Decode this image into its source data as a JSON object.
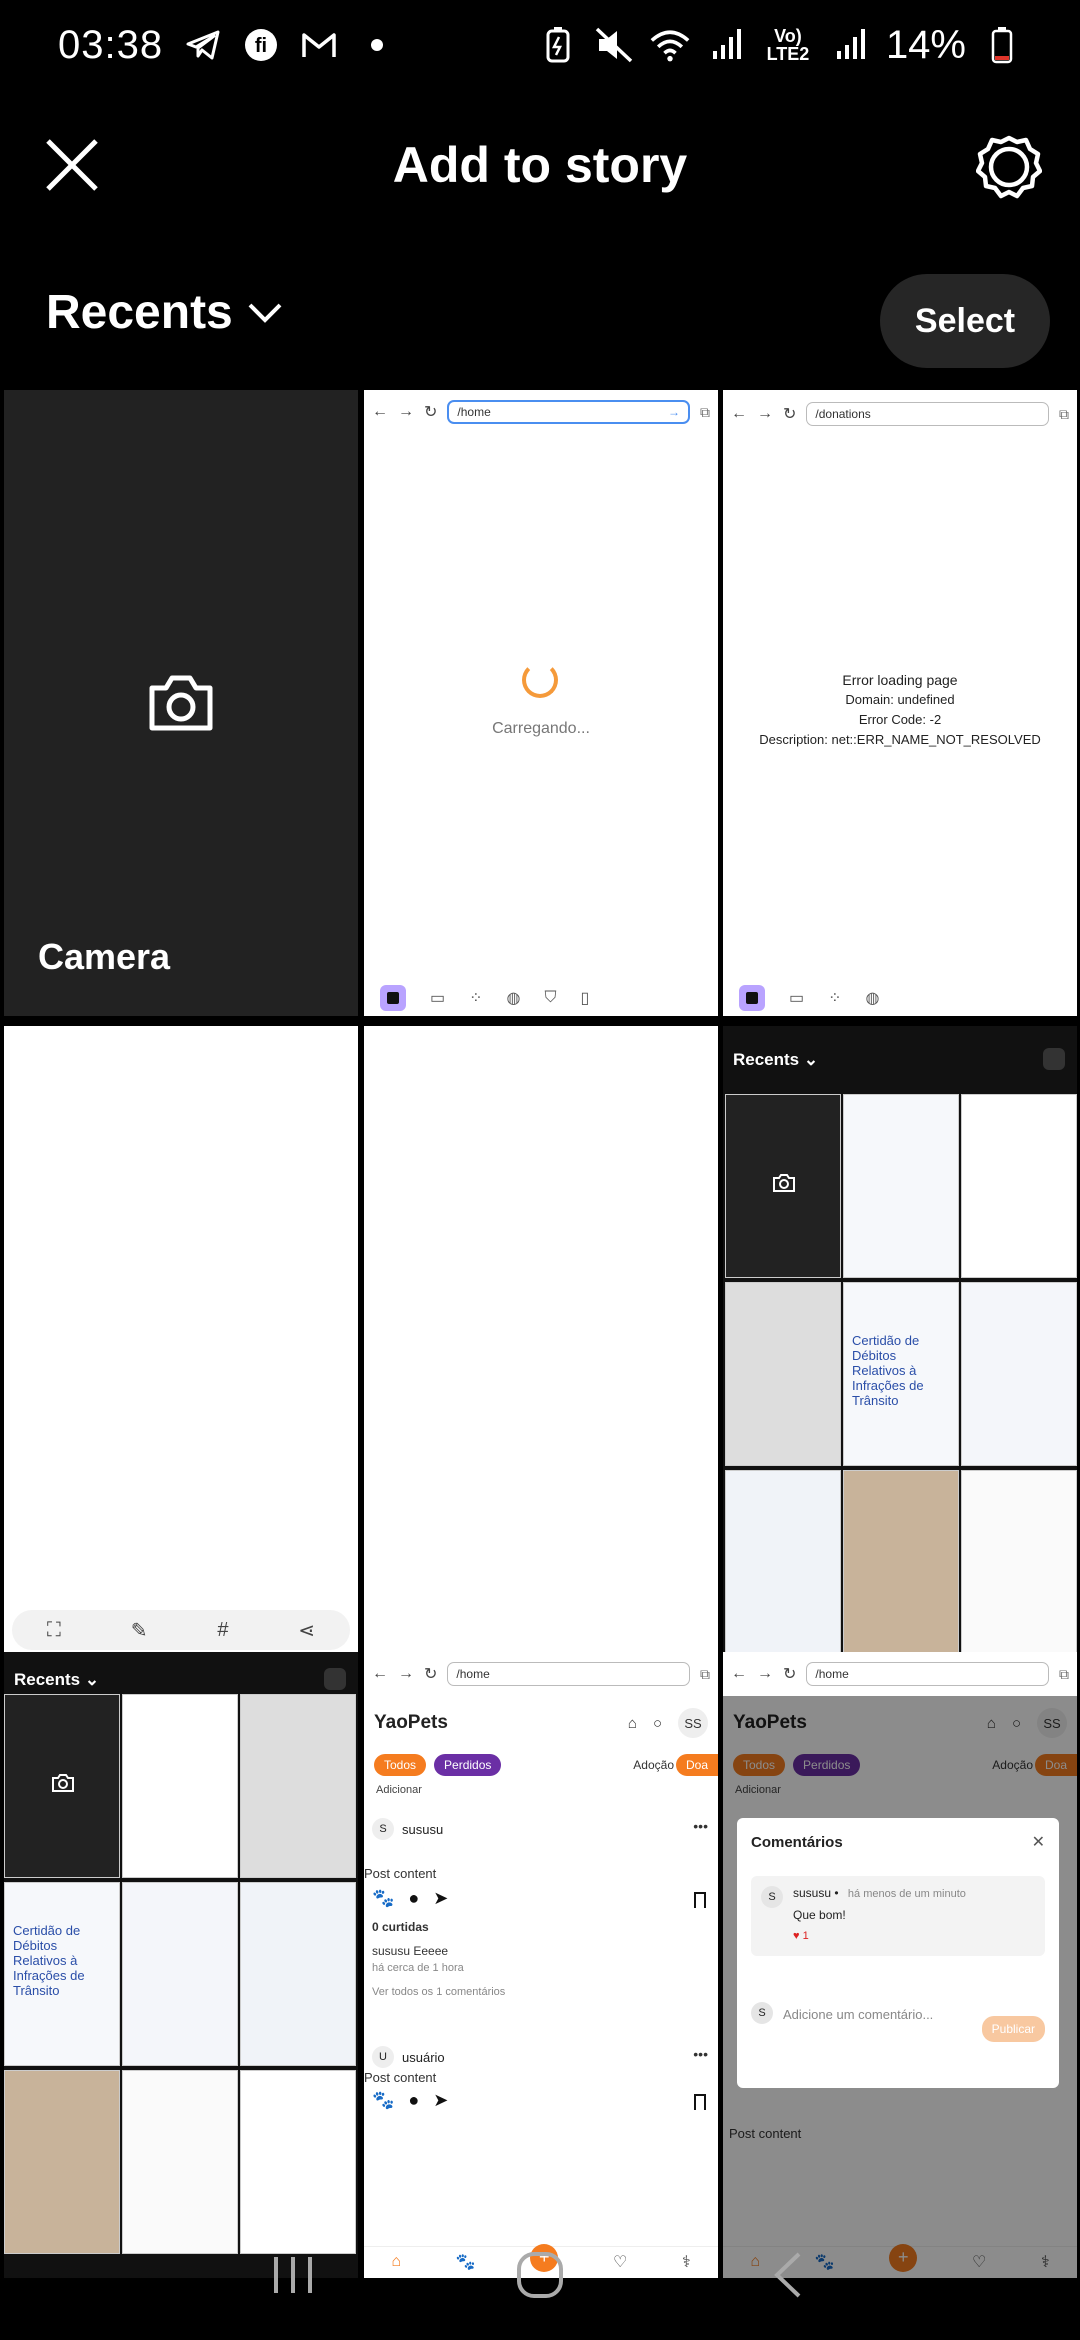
{
  "status_bar": {
    "time": "03:38",
    "battery": "14%",
    "network": "Vo) LTE2",
    "icons": [
      "telegram-icon",
      "threads-icon",
      "gmail-icon",
      "dot-icon",
      "battery-saver-icon",
      "mute-icon",
      "wifi-icon",
      "signal-icon",
      "battery-icon"
    ]
  },
  "header": {
    "title": "Add to story"
  },
  "recents": {
    "label": "Recents",
    "select_label": "Select"
  },
  "tiles": {
    "camera": {
      "label": "Camera"
    },
    "loading": {
      "url": "/home",
      "text": "Carregando..."
    },
    "error": {
      "url": "/donations",
      "title": "Error loading page",
      "domain": "Domain: undefined",
      "code": "Error Code: -2",
      "description": "Description: net::ERR_NAME_NOT_RESOLVED"
    },
    "nested": {
      "label": "Recents",
      "cert_title": "Certidão de Débitos Relativos à Infrações de Trânsito"
    },
    "yaopets": {
      "url": "/home",
      "brand": "YaoPets",
      "avatar": "SS",
      "chip_todos": "Todos",
      "chip_perdidos": "Perdidos",
      "adocao": "Adoção",
      "doa": "Doa",
      "adicionar": "Adicionar",
      "post1_user": "sususu",
      "post1_avatar": "S",
      "post_content": "Post content",
      "likes": "0 curtidas",
      "caption": "sususu Eeeee",
      "time_ago": "há cerca de 1 hora",
      "view_comments": "Ver todos os 1 comentários",
      "post2_user": "usuário",
      "post2_avatar": "U"
    },
    "comments_modal": {
      "title": "Comentários",
      "comment_user": "sususu",
      "comment_time": "há menos de um minuto",
      "comment_text": "Que bom!",
      "comment_likes": "1",
      "input_placeholder": "Adicione um comentário...",
      "publish": "Publicar",
      "avatar": "S"
    }
  },
  "colors": {
    "accent_orange": "#f57c1f",
    "accent_purple": "#6b2fa5",
    "select_bg": "#262626"
  }
}
